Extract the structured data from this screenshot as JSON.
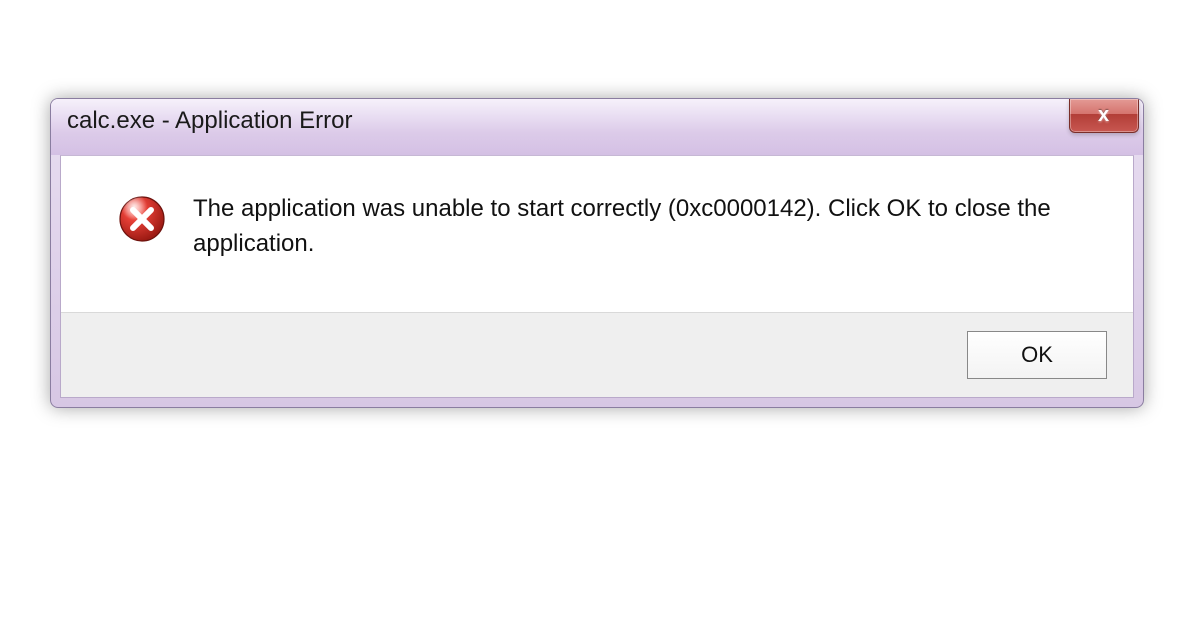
{
  "dialog": {
    "title": "calc.exe - Application Error",
    "message": "The application was unable to start correctly (0xc0000142). Click OK to close the application.",
    "ok_label": "OK",
    "icon": "error-icon",
    "close_glyph": "x"
  },
  "colors": {
    "frame_accent": "#d7c7e4",
    "close_red": "#c24641"
  }
}
